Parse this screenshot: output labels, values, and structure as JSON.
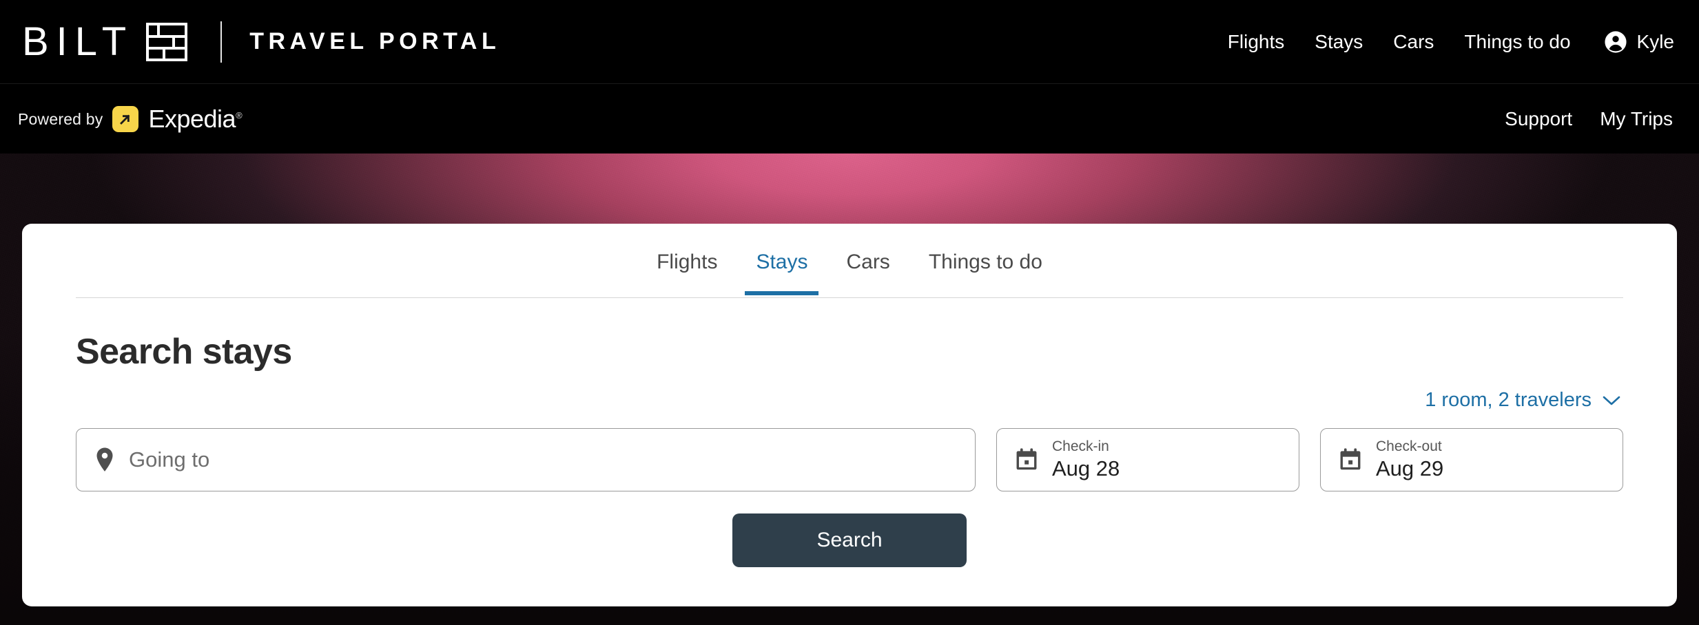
{
  "header": {
    "brand_name": "BILT",
    "brand_icon": "brick-grid-icon",
    "portal_title": "TRAVEL PORTAL",
    "nav": [
      {
        "label": "Flights"
      },
      {
        "label": "Stays"
      },
      {
        "label": "Cars"
      },
      {
        "label": "Things to do"
      }
    ],
    "account": {
      "icon": "account-circle-icon",
      "name": "Kyle"
    }
  },
  "partner_bar": {
    "powered_by_label": "Powered by",
    "partner_name": "Expedia",
    "partner_mark": "expedia-arrow-icon",
    "trademark": "®",
    "links": [
      {
        "label": "Support"
      },
      {
        "label": "My Trips"
      }
    ]
  },
  "search_card": {
    "tabs": [
      {
        "label": "Flights",
        "active": false
      },
      {
        "label": "Stays",
        "active": true
      },
      {
        "label": "Cars",
        "active": false
      },
      {
        "label": "Things to do",
        "active": false
      }
    ],
    "title": "Search stays",
    "travelers": {
      "summary": "1 room, 2 travelers",
      "chevron": "chevron-down-icon"
    },
    "destination": {
      "icon": "map-pin-icon",
      "placeholder": "Going to",
      "value": ""
    },
    "check_in": {
      "icon": "calendar-icon",
      "label": "Check-in",
      "value": "Aug 28"
    },
    "check_out": {
      "icon": "calendar-icon",
      "label": "Check-out",
      "value": "Aug 29"
    },
    "submit_label": "Search"
  },
  "colors": {
    "accent_blue": "#1d6fa5",
    "button_slate": "#2f3f4b",
    "expedia_yellow": "#f7d54a",
    "hero_pink": "#d2567e",
    "header_black": "#000000"
  }
}
